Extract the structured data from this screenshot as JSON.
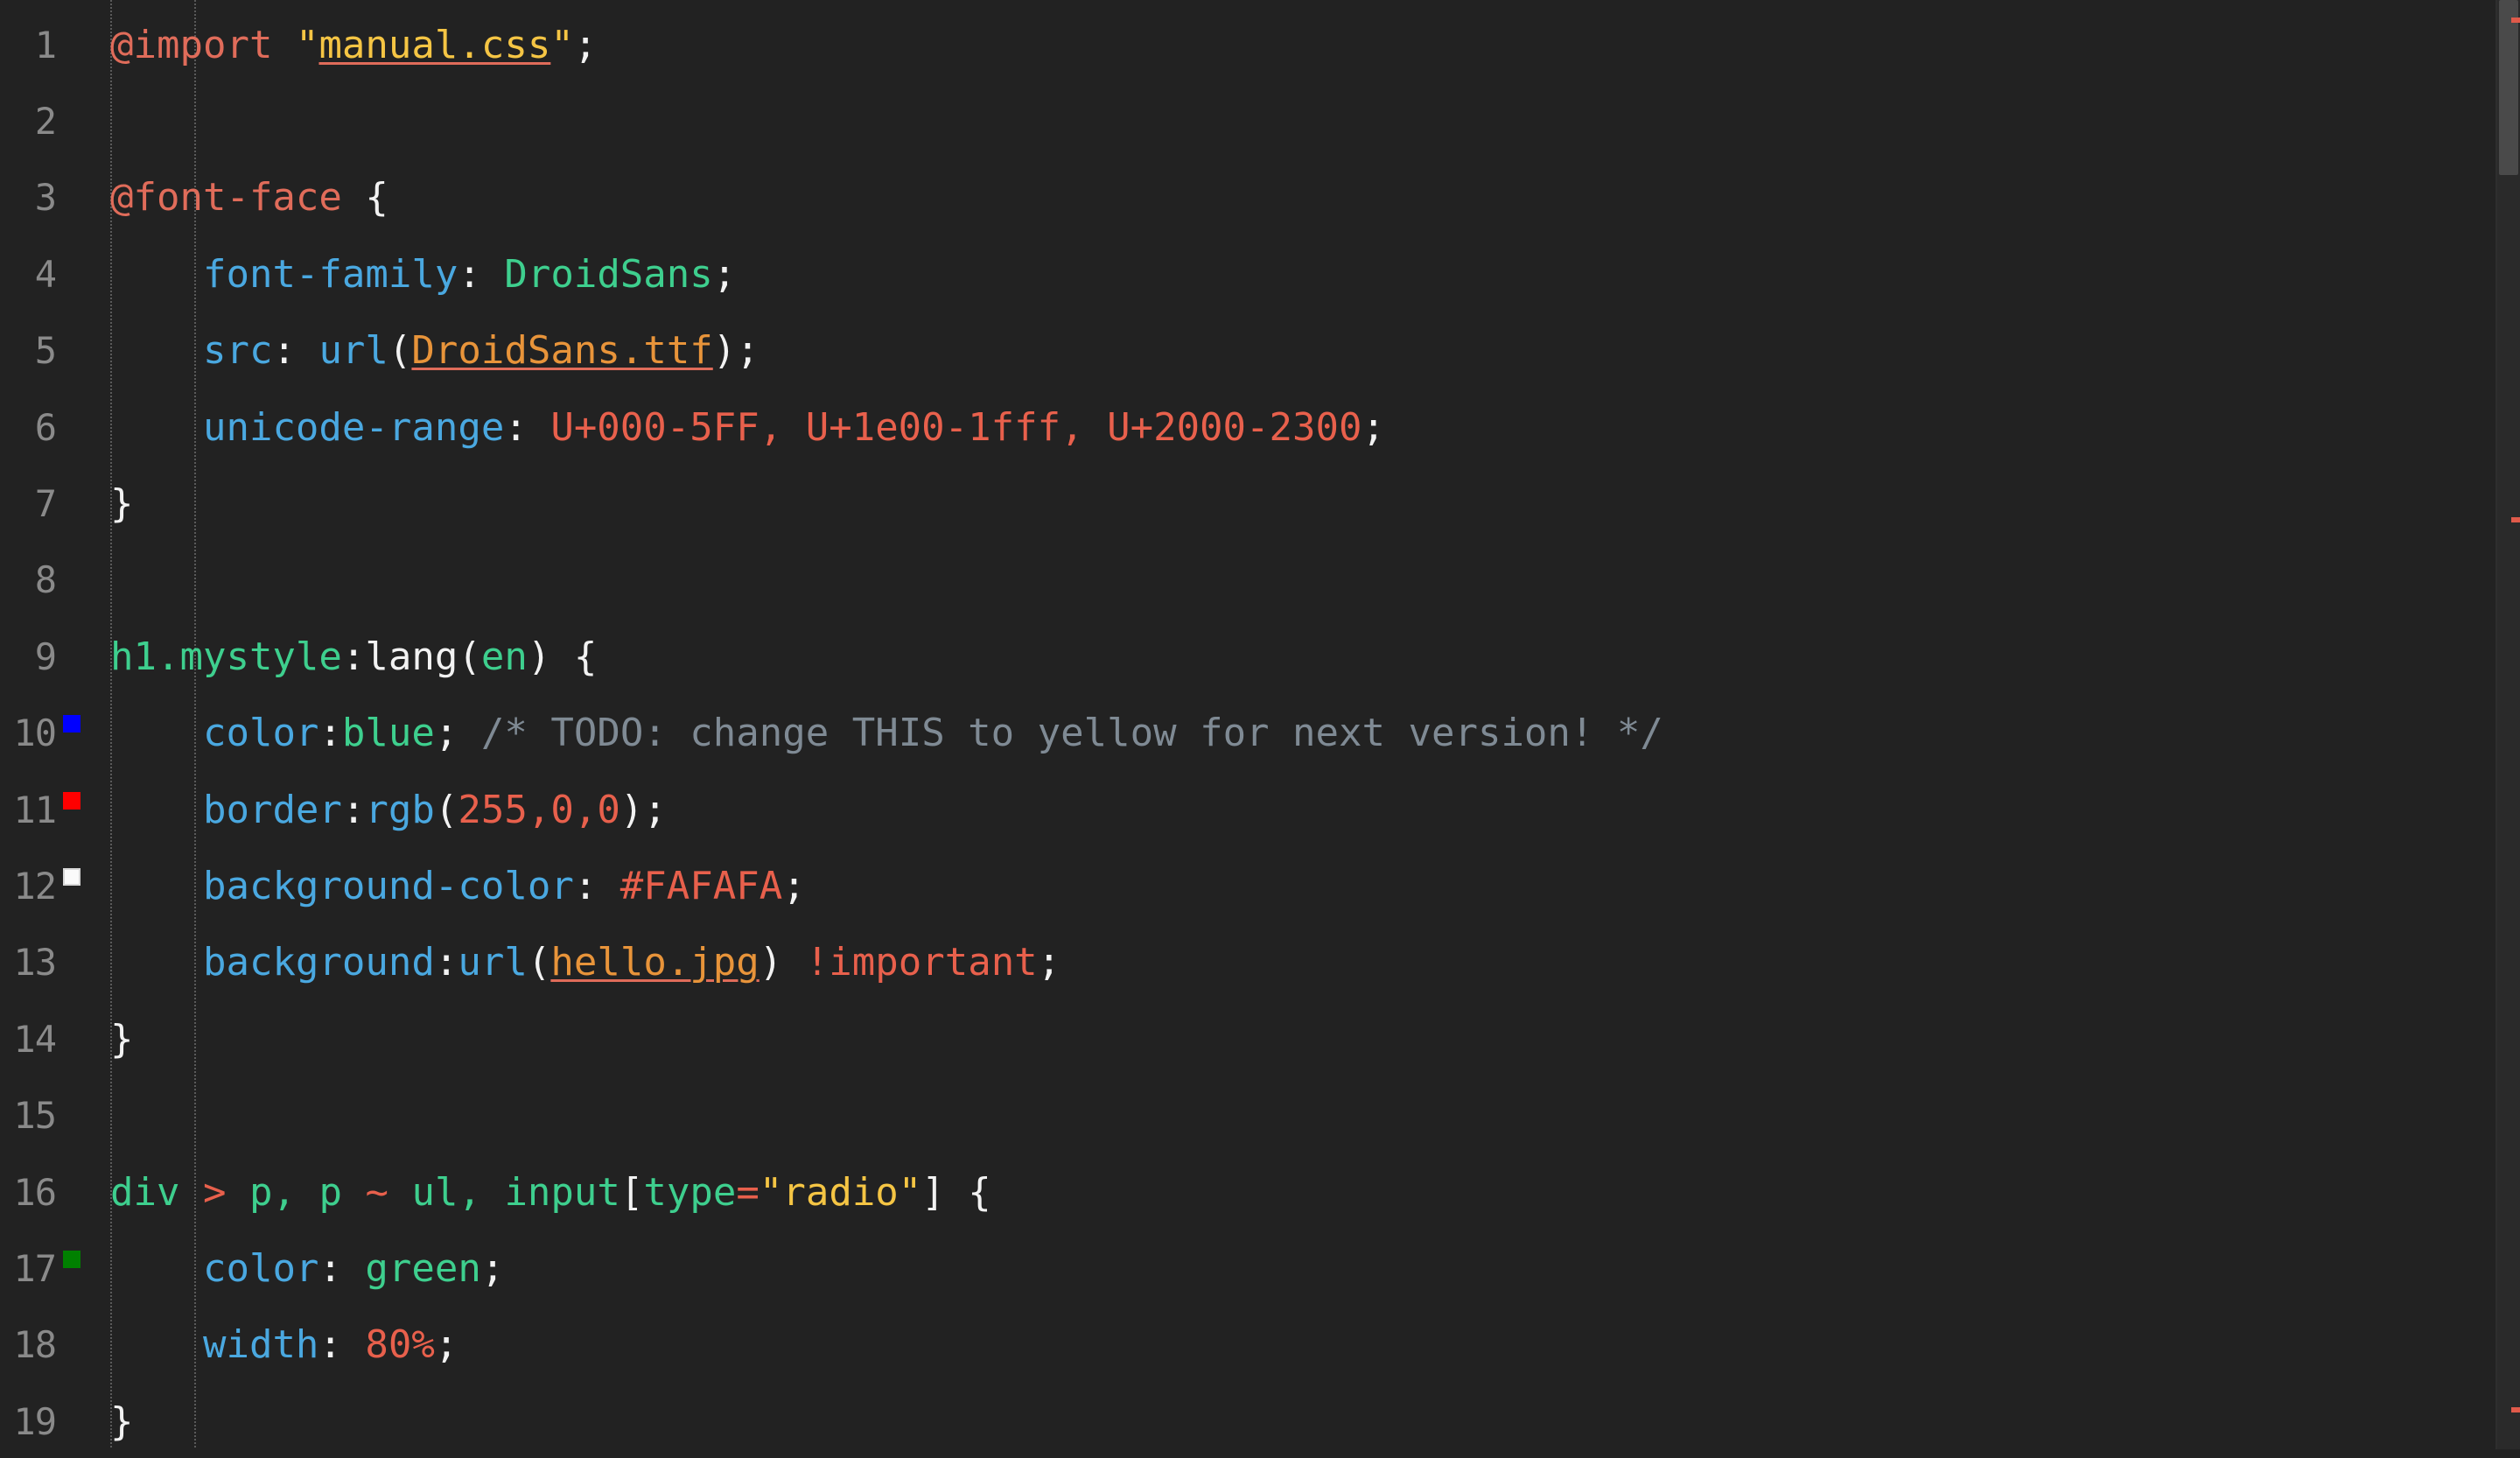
{
  "editor": {
    "language": "CSS",
    "theme_background": "#222222",
    "gutter_text_color": "#8a8a8a",
    "total_lines": 19,
    "first_visible_line": 1,
    "last_visible_line": 19
  },
  "line_numbers": [
    "1",
    "2",
    "3",
    "4",
    "5",
    "6",
    "7",
    "8",
    "9",
    "10",
    "11",
    "12",
    "13",
    "14",
    "15",
    "16",
    "17",
    "18",
    "19"
  ],
  "color_swatches": [
    {
      "line": 10,
      "value": "#0000FF",
      "source_text": "blue"
    },
    {
      "line": 11,
      "value": "#FF0000",
      "source_text": "rgb(255,0,0)"
    },
    {
      "line": 12,
      "value": "#FAFAFA",
      "source_text": "#FAFAFA"
    },
    {
      "line": 17,
      "value": "#008000",
      "source_text": "green"
    }
  ],
  "lines": [
    {
      "number": "1",
      "text": "@import \"manual.css\";",
      "tokens": [
        {
          "text": "@import",
          "type": "at-rule"
        },
        {
          "text": " ",
          "type": "plain"
        },
        {
          "text": "\"",
          "type": "string"
        },
        {
          "text": "manual.css",
          "type": "link"
        },
        {
          "text": "\"",
          "type": "string"
        },
        {
          "text": ";",
          "type": "plain"
        }
      ]
    },
    {
      "number": "2",
      "text": "",
      "tokens": []
    },
    {
      "number": "3",
      "text": "@font-face {",
      "tokens": [
        {
          "text": "@font-face",
          "type": "at-rule"
        },
        {
          "text": " {",
          "type": "plain"
        }
      ]
    },
    {
      "number": "4",
      "text": "    font-family: DroidSans;",
      "tokens": [
        {
          "text": "    ",
          "type": "plain"
        },
        {
          "text": "font-family",
          "type": "property"
        },
        {
          "text": ": ",
          "type": "plain"
        },
        {
          "text": "DroidSans",
          "type": "value"
        },
        {
          "text": ";",
          "type": "plain"
        }
      ]
    },
    {
      "number": "5",
      "text": "    src: url(DroidSans.ttf);",
      "tokens": [
        {
          "text": "    ",
          "type": "plain"
        },
        {
          "text": "src",
          "type": "property"
        },
        {
          "text": ": ",
          "type": "plain"
        },
        {
          "text": "url",
          "type": "property"
        },
        {
          "text": "(",
          "type": "plain"
        },
        {
          "text": "DroidSans.ttf",
          "type": "url"
        },
        {
          "text": ");",
          "type": "plain"
        }
      ]
    },
    {
      "number": "6",
      "text": "    unicode-range: U+000-5FF, U+1e00-1fff, U+2000-2300;",
      "tokens": [
        {
          "text": "    ",
          "type": "plain"
        },
        {
          "text": "unicode-range",
          "type": "property"
        },
        {
          "text": ": ",
          "type": "plain"
        },
        {
          "text": "U+000-5FF, U+1e00-1fff, U+2000-2300",
          "type": "number"
        },
        {
          "text": ";",
          "type": "plain"
        }
      ]
    },
    {
      "number": "7",
      "text": "}",
      "tokens": [
        {
          "text": "}",
          "type": "plain"
        }
      ]
    },
    {
      "number": "8",
      "text": "",
      "tokens": []
    },
    {
      "number": "9",
      "text": "h1.mystyle:lang(en) {",
      "tokens": [
        {
          "text": "h1.mystyle",
          "type": "selector"
        },
        {
          "text": ":lang(",
          "type": "plain"
        },
        {
          "text": "en",
          "type": "selector"
        },
        {
          "text": ") {",
          "type": "plain"
        }
      ]
    },
    {
      "number": "10",
      "text": "    color:blue; /* TODO: change THIS to yellow for next version! */",
      "tokens": [
        {
          "text": "    ",
          "type": "plain"
        },
        {
          "text": "color",
          "type": "property"
        },
        {
          "text": ":",
          "type": "plain"
        },
        {
          "text": "blue",
          "type": "value"
        },
        {
          "text": "; ",
          "type": "plain"
        },
        {
          "text": "/* TODO: change THIS to yellow for next version! */",
          "type": "comment"
        }
      ]
    },
    {
      "number": "11",
      "text": "    border:rgb(255,0,0);",
      "tokens": [
        {
          "text": "    ",
          "type": "plain"
        },
        {
          "text": "border",
          "type": "property"
        },
        {
          "text": ":",
          "type": "plain"
        },
        {
          "text": "rgb",
          "type": "property"
        },
        {
          "text": "(",
          "type": "plain"
        },
        {
          "text": "255,0,0",
          "type": "number"
        },
        {
          "text": ");",
          "type": "plain"
        }
      ]
    },
    {
      "number": "12",
      "text": "    background-color: #FAFAFA;",
      "tokens": [
        {
          "text": "    ",
          "type": "plain"
        },
        {
          "text": "background-color",
          "type": "property"
        },
        {
          "text": ": ",
          "type": "plain"
        },
        {
          "text": "#FAFAFA",
          "type": "number"
        },
        {
          "text": ";",
          "type": "plain"
        }
      ]
    },
    {
      "number": "13",
      "text": "    background:url(hello.jpg) !important;",
      "tokens": [
        {
          "text": "    ",
          "type": "plain"
        },
        {
          "text": "background",
          "type": "property"
        },
        {
          "text": ":",
          "type": "plain"
        },
        {
          "text": "url",
          "type": "property"
        },
        {
          "text": "(",
          "type": "plain"
        },
        {
          "text": "hello.jpg",
          "type": "url"
        },
        {
          "text": ") ",
          "type": "plain"
        },
        {
          "text": "!important",
          "type": "important"
        },
        {
          "text": ";",
          "type": "plain"
        }
      ]
    },
    {
      "number": "14",
      "text": "}",
      "tokens": [
        {
          "text": "}",
          "type": "plain"
        }
      ]
    },
    {
      "number": "15",
      "text": "",
      "tokens": []
    },
    {
      "number": "16",
      "text": "div > p, p ~ ul, input[type=\"radio\"] {",
      "tokens": [
        {
          "text": "div",
          "type": "selector"
        },
        {
          "text": " ",
          "type": "plain"
        },
        {
          "text": ">",
          "type": "combinator"
        },
        {
          "text": " ",
          "type": "plain"
        },
        {
          "text": "p",
          "type": "selector"
        },
        {
          "text": ", ",
          "type": "selector"
        },
        {
          "text": "p",
          "type": "selector"
        },
        {
          "text": " ",
          "type": "plain"
        },
        {
          "text": "~",
          "type": "combinator"
        },
        {
          "text": " ",
          "type": "plain"
        },
        {
          "text": "ul",
          "type": "selector"
        },
        {
          "text": ", ",
          "type": "selector"
        },
        {
          "text": "input",
          "type": "selector"
        },
        {
          "text": "[",
          "type": "plain"
        },
        {
          "text": "type",
          "type": "selector"
        },
        {
          "text": "=",
          "type": "combinator"
        },
        {
          "text": "\"radio\"",
          "type": "attr-string"
        },
        {
          "text": "] {",
          "type": "plain"
        }
      ]
    },
    {
      "number": "17",
      "text": "    color: green;",
      "tokens": [
        {
          "text": "    ",
          "type": "plain"
        },
        {
          "text": "color",
          "type": "property"
        },
        {
          "text": ": ",
          "type": "plain"
        },
        {
          "text": "green",
          "type": "value"
        },
        {
          "text": ";",
          "type": "plain"
        }
      ]
    },
    {
      "number": "18",
      "text": "    width: 80%;",
      "tokens": [
        {
          "text": "    ",
          "type": "plain"
        },
        {
          "text": "width",
          "type": "property"
        },
        {
          "text": ": ",
          "type": "plain"
        },
        {
          "text": "80%",
          "type": "number"
        },
        {
          "text": ";",
          "type": "plain"
        }
      ]
    },
    {
      "number": "19",
      "text": "}",
      "tokens": [
        {
          "text": "}",
          "type": "plain"
        }
      ]
    }
  ],
  "scrollbar": {
    "orientation": "vertical",
    "thumb_top_pct": 0,
    "thumb_height_pct": 12,
    "marks": [
      {
        "top_pct": 1.2,
        "color": "#e05a4a"
      },
      {
        "top_pct": 35.5,
        "color": "#e05a4a"
      },
      {
        "top_pct": 96.5,
        "color": "#e05a4a"
      }
    ]
  },
  "token_colors": {
    "at-rule": "#e06c5a",
    "string": "#f5c544",
    "link": "#f5c544",
    "url": "#e8943a",
    "plain": "#f2f2f2",
    "property": "#3fa9e8",
    "value": "#3ecf8e",
    "number": "#e8604c",
    "comment": "#7f8a94",
    "selector": "#3ecf8e",
    "combinator": "#e8604c",
    "attr-string": "#f5c544",
    "important": "#e8604c"
  }
}
